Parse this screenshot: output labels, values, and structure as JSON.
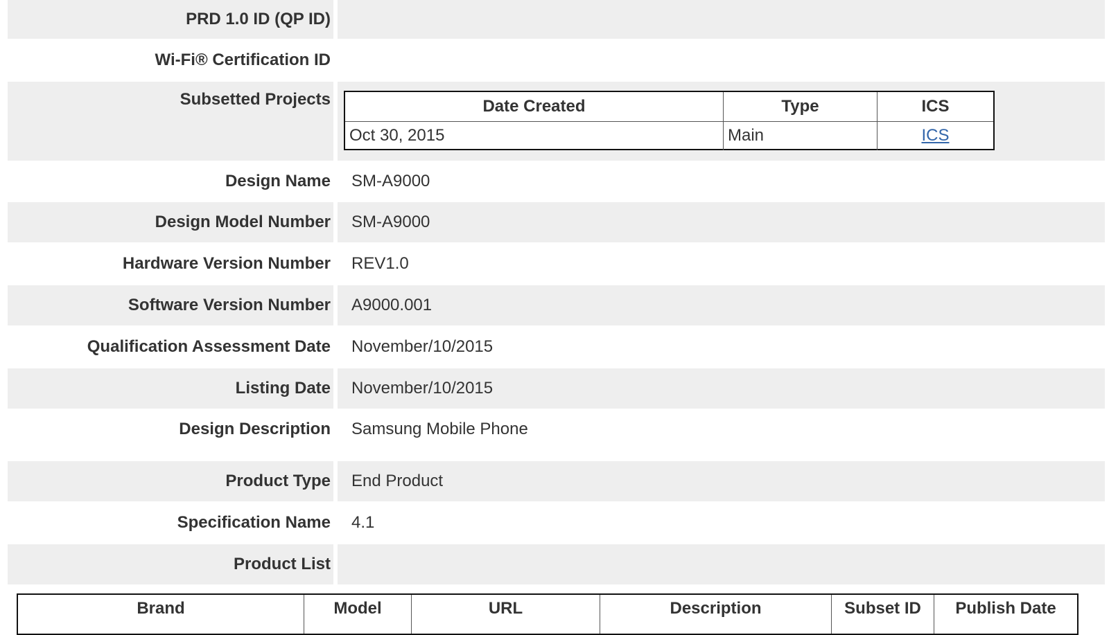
{
  "fields": {
    "prd_id": {
      "label": "PRD 1.0 ID (QP ID)",
      "value": ""
    },
    "wifi_cert": {
      "label": "Wi-Fi® Certification ID",
      "value": ""
    },
    "subsetted_projects": {
      "label": "Subsetted Projects"
    },
    "design_name": {
      "label": "Design Name",
      "value": "SM-A9000"
    },
    "design_model_number": {
      "label": "Design Model Number",
      "value": "SM-A9000"
    },
    "hardware_version": {
      "label": "Hardware Version Number",
      "value": "REV1.0"
    },
    "software_version": {
      "label": "Software Version Number",
      "value": "A9000.001"
    },
    "qualification_date": {
      "label": "Qualification Assessment Date",
      "value": "November/10/2015"
    },
    "listing_date": {
      "label": "Listing Date",
      "value": "November/10/2015"
    },
    "design_description": {
      "label": "Design Description",
      "value": "Samsung Mobile Phone"
    },
    "product_type": {
      "label": "Product Type",
      "value": "End Product"
    },
    "specification_name": {
      "label": "Specification Name",
      "value": "4.1"
    },
    "product_list": {
      "label": "Product List"
    }
  },
  "subset_table": {
    "headers": [
      "Date Created",
      "Type",
      "ICS"
    ],
    "rows": [
      {
        "date_created": "Oct 30, 2015",
        "type": "Main",
        "ics": "ICS"
      }
    ]
  },
  "product_table": {
    "headers": [
      "Brand",
      "Model",
      "URL",
      "Description",
      "Subset ID",
      "Publish Date"
    ]
  },
  "colors": {
    "row_shade": "#eeeeee",
    "link": "#3366aa",
    "text": "#333333"
  }
}
